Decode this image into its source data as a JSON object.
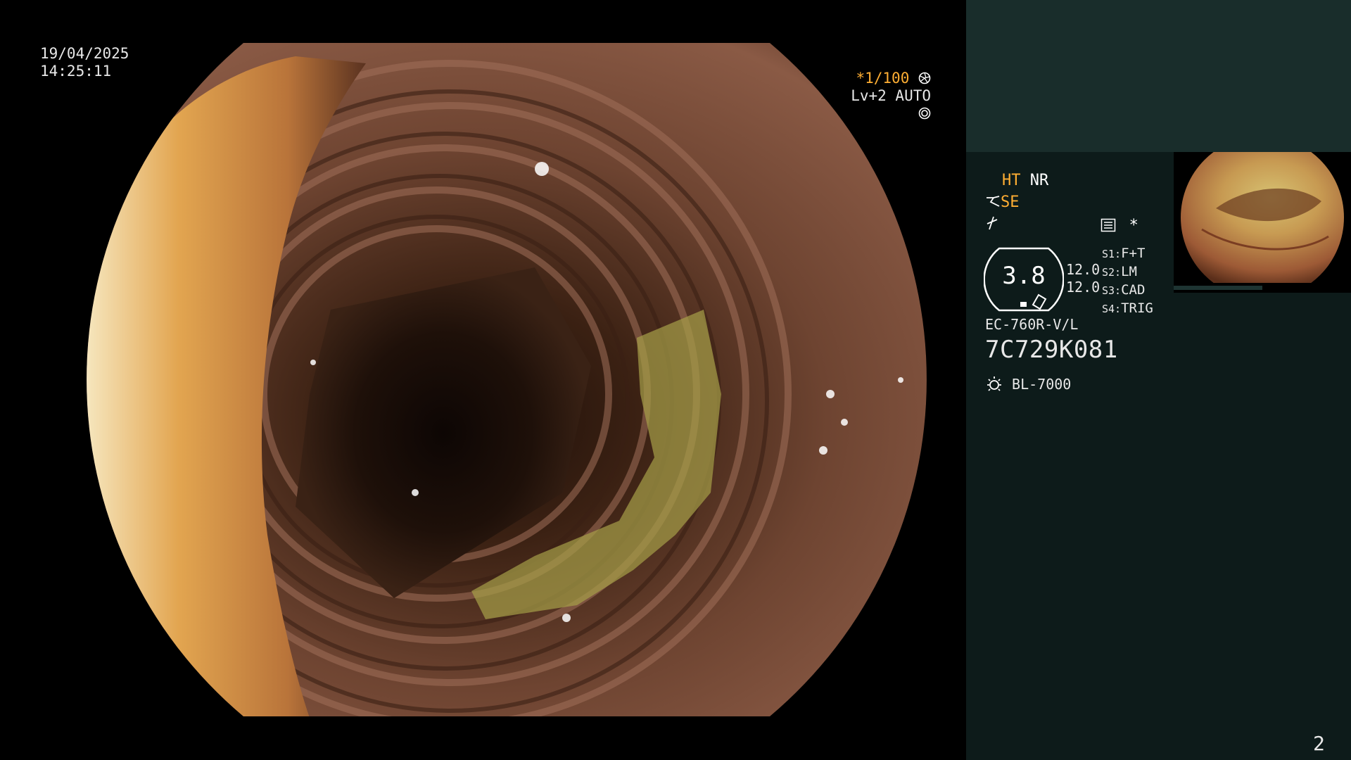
{
  "osd": {
    "date": "19/04/2025",
    "time": "14:25:11",
    "shutter": "*1/100",
    "level": "Lv+2",
    "iris_mode": "AUTO"
  },
  "panel": {
    "mode_ht": "HT",
    "mode_nr": "NR",
    "mode_se": "SE",
    "asterisk": "*",
    "gauge_value": "3.8",
    "setting_a": "12.0",
    "setting_b": "12.0",
    "switches": [
      {
        "key": "S1:",
        "value": "F+T"
      },
      {
        "key": "S2:",
        "value": "LM"
      },
      {
        "key": "S3:",
        "value": "CAD"
      },
      {
        "key": "S4:",
        "value": "TRIG"
      }
    ],
    "scope_model": "EC-760R-V/L",
    "scope_serial": "7C729K081",
    "light_source": "BL-7000",
    "page_number": "2"
  },
  "colors": {
    "accent_orange": "#ffae33",
    "panel_bg": "#0d1b1a",
    "panel_top_bg": "#192d2b"
  },
  "icons": {
    "shutter_icon": "aperture-icon",
    "iris_icon": "iris-icon",
    "scope_icon": "scope-tip-icon",
    "lamp_icon": "lamp-icon",
    "settings_icon": "list-settings-icon"
  }
}
